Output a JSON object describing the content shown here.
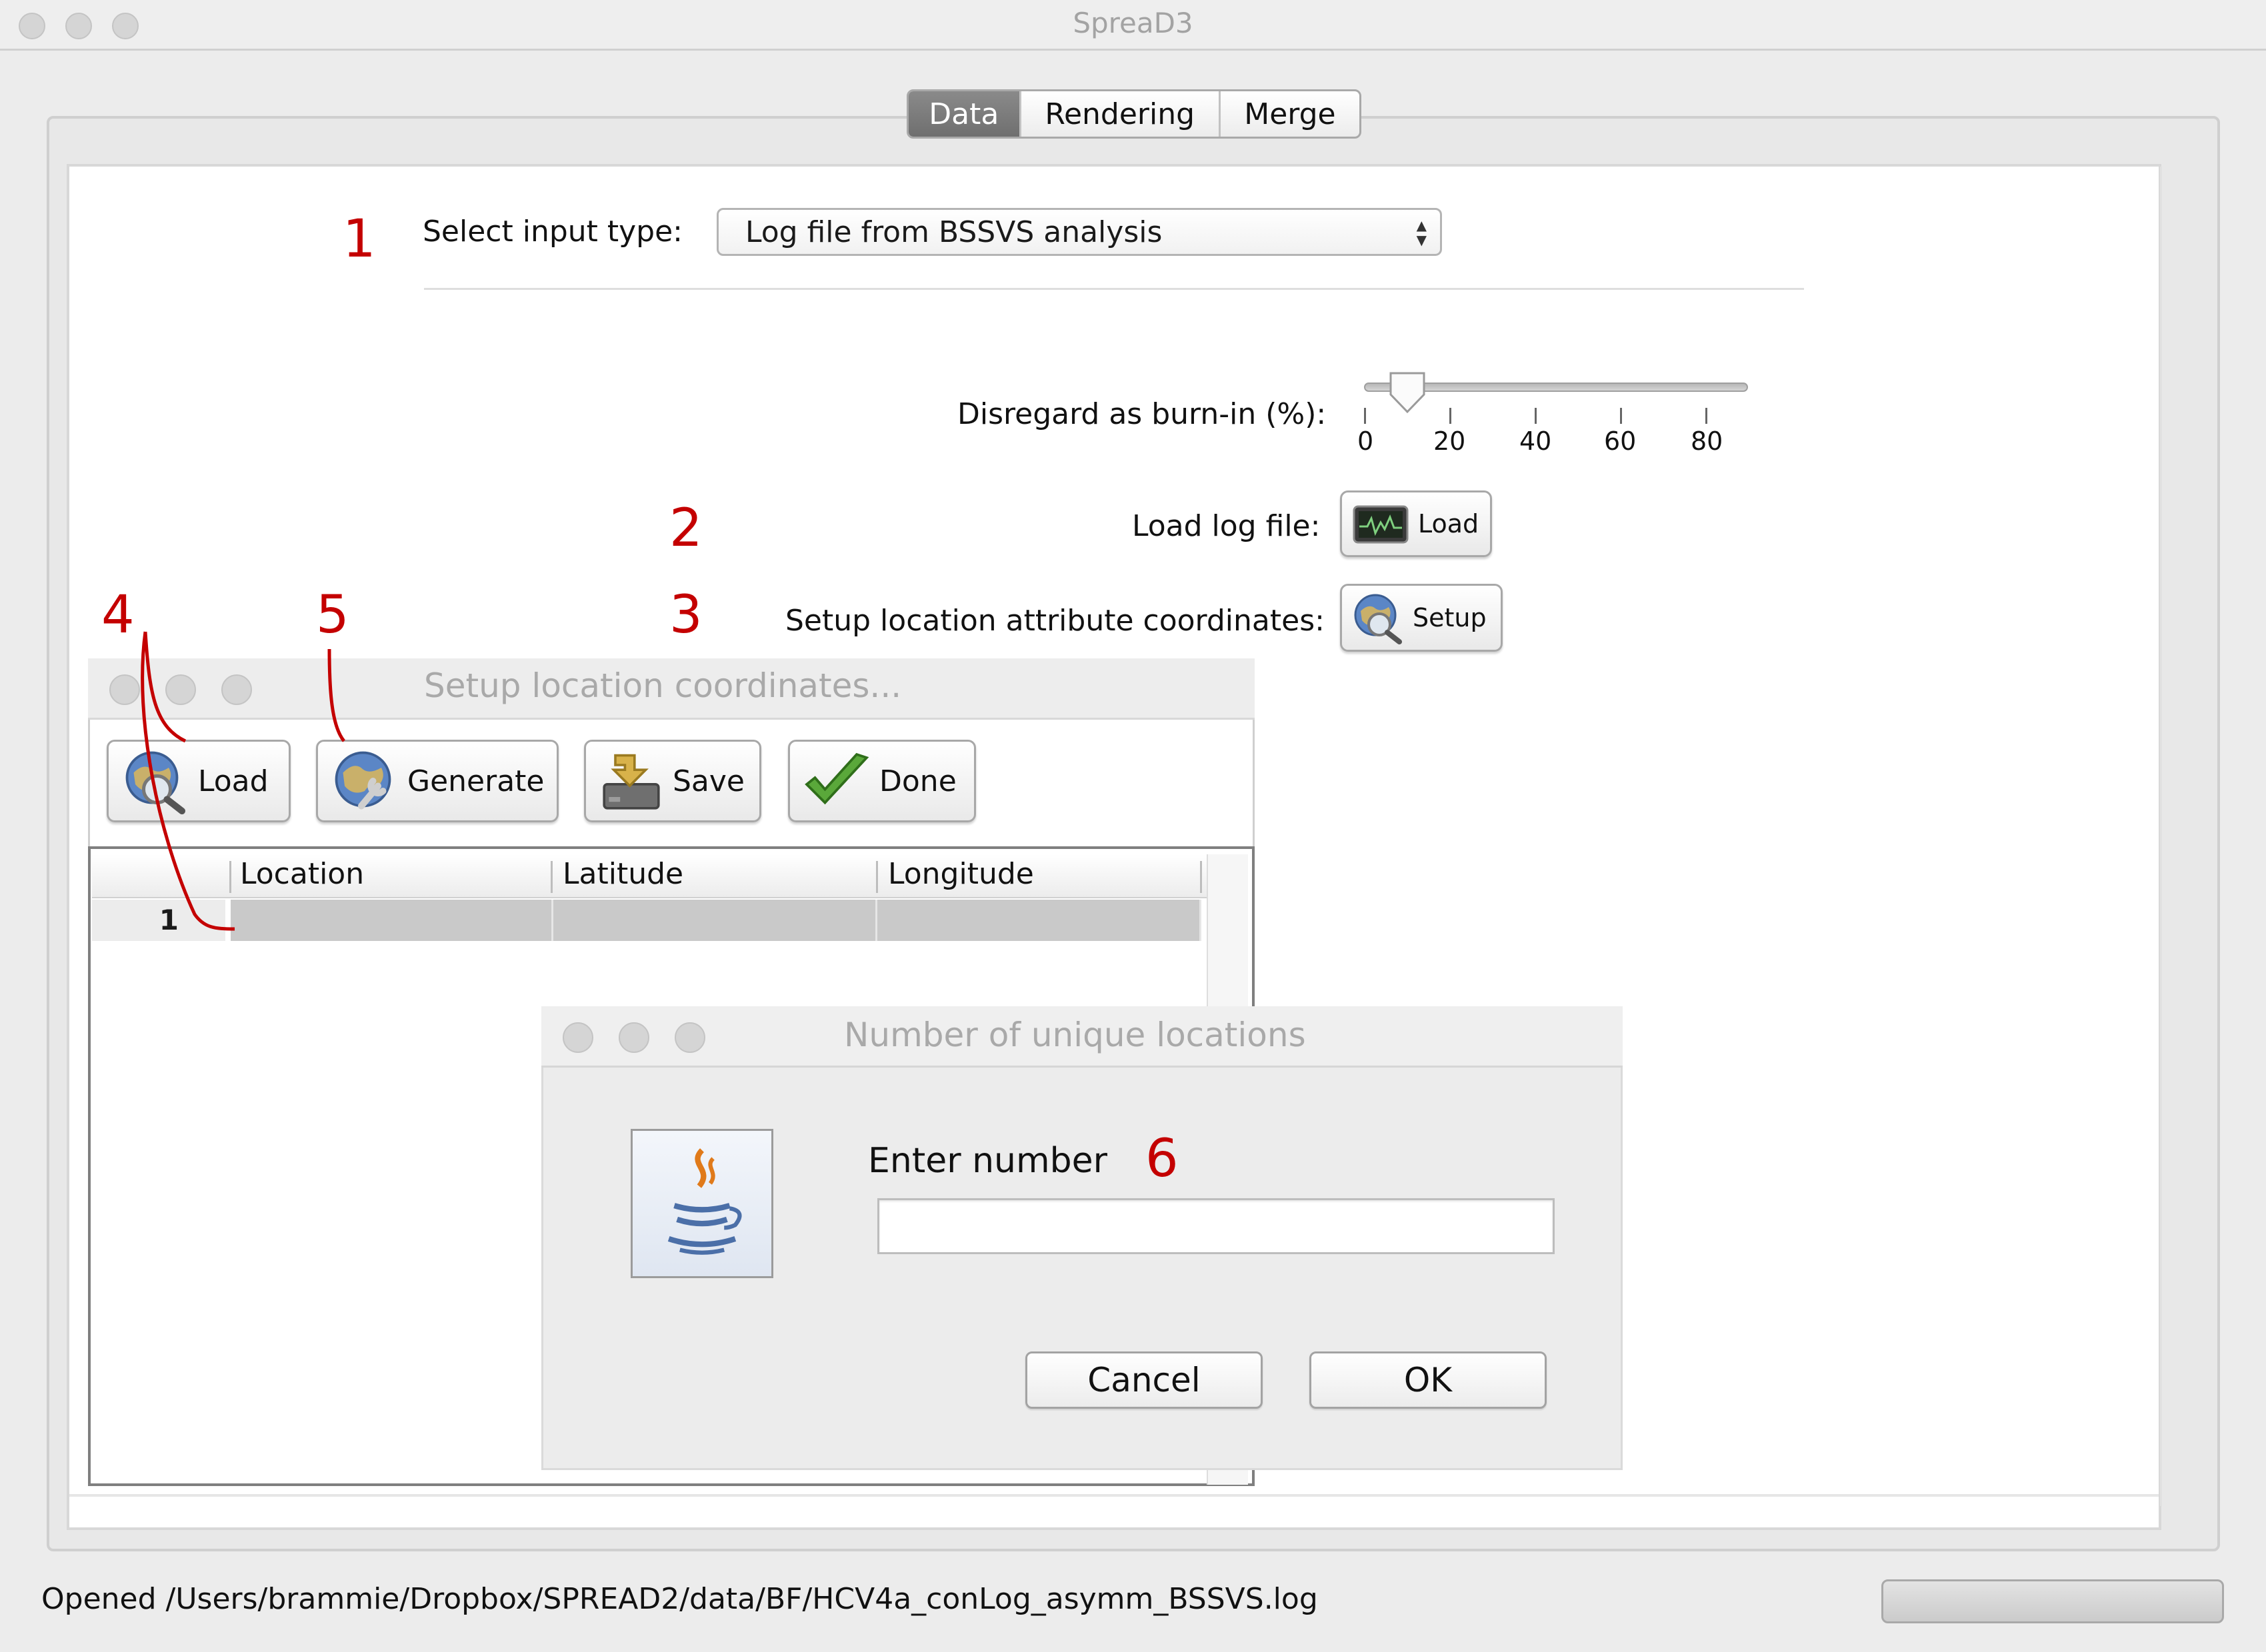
{
  "window": {
    "title": "SpreaD3"
  },
  "tabs": [
    {
      "label": "Data",
      "active": true
    },
    {
      "label": "Rendering",
      "active": false
    },
    {
      "label": "Merge",
      "active": false
    }
  ],
  "data_tab": {
    "input_type_label": "Select input type:",
    "input_type_value": "Log file from BSSVS analysis",
    "burnin_label": "Disregard as burn-in (%):",
    "burnin_value_percent": 10,
    "burnin_ticks": [
      "0",
      "20",
      "40",
      "60",
      "80"
    ],
    "load_log_label": "Load log file:",
    "load_button": "Load",
    "setup_coords_label": "Setup location attribute coordinates:",
    "setup_button": "Setup"
  },
  "annotations": [
    "1",
    "2",
    "3",
    "4",
    "5",
    "6"
  ],
  "setup_dialog": {
    "title": "Setup location coordinates...",
    "toolbar": {
      "load": "Load",
      "generate": "Generate",
      "save": "Save",
      "done": "Done"
    },
    "table": {
      "columns": [
        "Location",
        "Latitude",
        "Longitude"
      ],
      "rows": [
        {
          "index": "1",
          "location": "",
          "latitude": "",
          "longitude": ""
        }
      ]
    }
  },
  "number_dialog": {
    "title": "Number of unique locations",
    "prompt": "Enter number",
    "input_value": "",
    "cancel": "Cancel",
    "ok": "OK"
  },
  "status": {
    "message": "Opened /Users/brammie/Dropbox/SPREAD2/data/BF/HCV4a_conLog_asymm_BSSVS.log"
  },
  "colors": {
    "annotation_red": "#c40000",
    "active_tab": "#7a7a7a"
  }
}
